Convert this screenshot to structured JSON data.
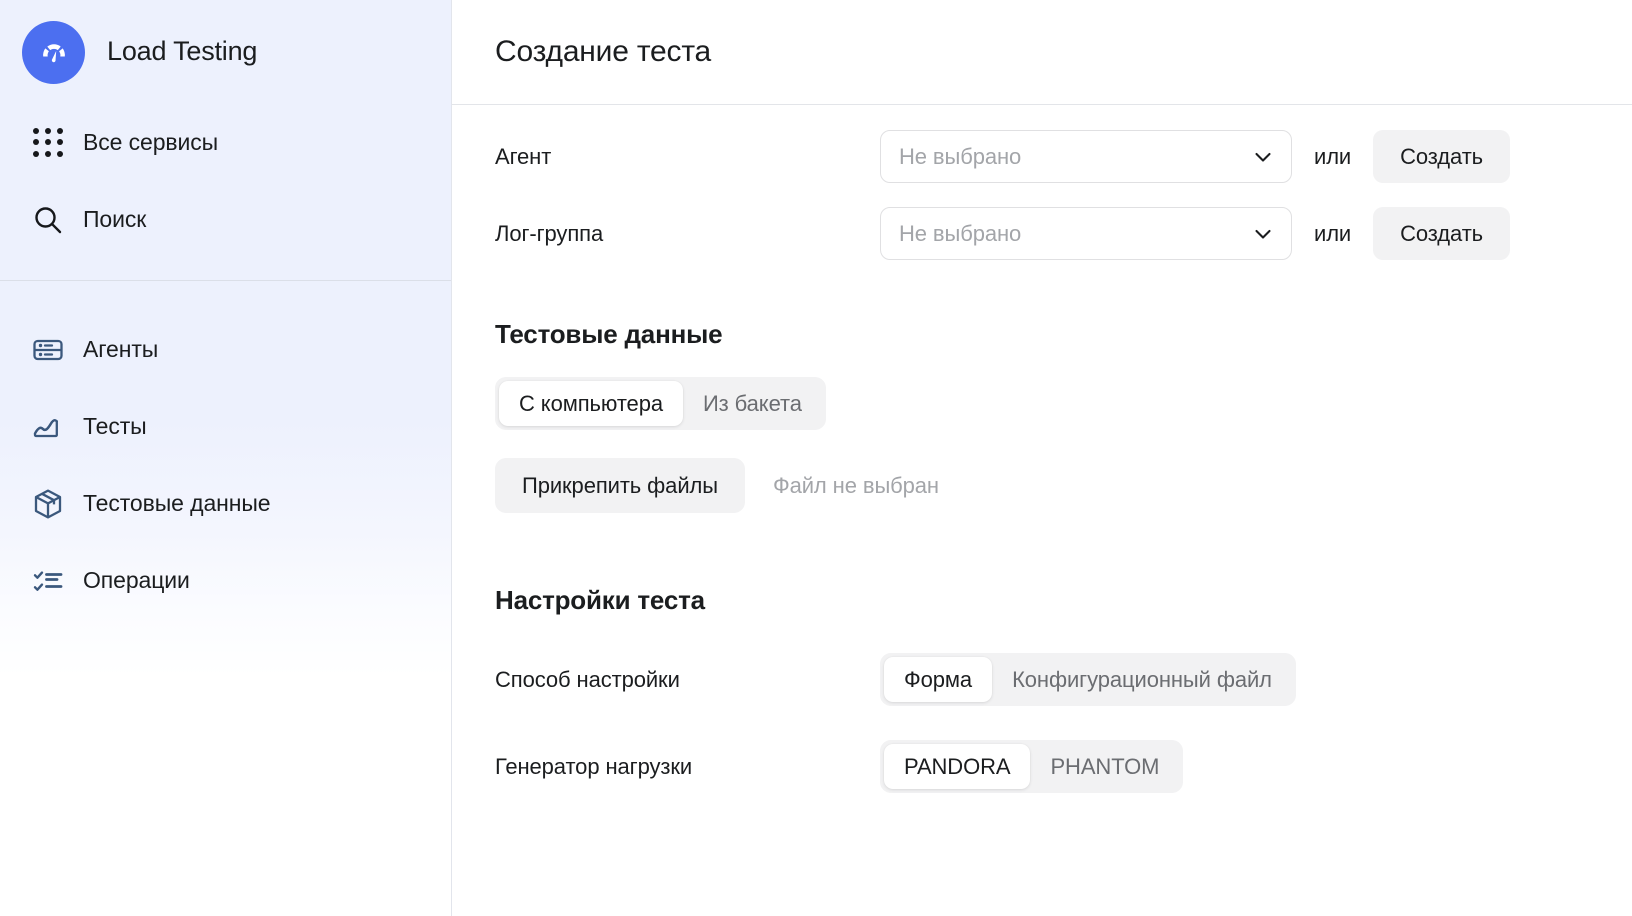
{
  "brand": {
    "title": "Load Testing",
    "logo_icon": "speedometer-icon",
    "logo_color": "#4c6ff0"
  },
  "sidebar": {
    "top_items": [
      {
        "label": "Все сервисы",
        "icon": "grid-dots-icon"
      },
      {
        "label": "Поиск",
        "icon": "search-icon"
      }
    ],
    "main_items": [
      {
        "label": "Агенты",
        "icon": "server-icon"
      },
      {
        "label": "Тесты",
        "icon": "chart-line-icon"
      },
      {
        "label": "Тестовые данные",
        "icon": "box-icon"
      },
      {
        "label": "Операции",
        "icon": "checklist-icon"
      }
    ],
    "background_color": "#edf1fd",
    "icon_color": "#3b587d"
  },
  "header": {
    "title": "Создание теста"
  },
  "form": {
    "rows": [
      {
        "label": "Агент",
        "select_placeholder": "Не выбрано",
        "select_value": "",
        "chevron_icon": "chevron-down-icon",
        "or_label": "или",
        "button_label": "Создать"
      },
      {
        "label": "Лог-группа",
        "select_placeholder": "Не выбрано",
        "select_value": "",
        "chevron_icon": "chevron-down-icon",
        "or_label": "или",
        "button_label": "Создать"
      }
    ]
  },
  "test_data": {
    "title": "Тестовые данные",
    "source_tabs": [
      {
        "label": "С компьютера",
        "active": true
      },
      {
        "label": "Из бакета",
        "active": false
      }
    ],
    "attach_button_label": "Прикрепить файлы",
    "file_status": "Файл не выбран"
  },
  "test_settings": {
    "title": "Настройки теста",
    "rows": [
      {
        "label": "Способ настройки",
        "options": [
          {
            "label": "Форма",
            "active": true
          },
          {
            "label": "Конфигурационный файл",
            "active": false
          }
        ]
      },
      {
        "label": "Генератор нагрузки",
        "options": [
          {
            "label": "PANDORA",
            "active": true
          },
          {
            "label": "PHANTOM",
            "active": false
          }
        ]
      }
    ]
  },
  "colors": {
    "accent": "#4c6ff0",
    "sidebar_bg": "#edf1fd",
    "control_bg": "#f2f2f3",
    "muted_text": "#a3a5a9",
    "text": "#1b1d1f"
  }
}
